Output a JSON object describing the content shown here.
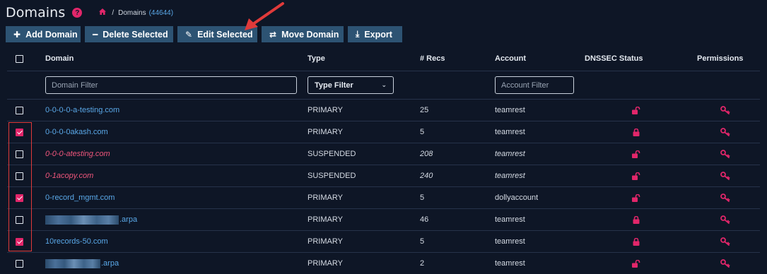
{
  "header": {
    "title": "Domains",
    "help": "?",
    "breadcrumb_sep": "/",
    "breadcrumb_label": "Domains",
    "breadcrumb_count": "(44644)"
  },
  "toolbar": {
    "add": "Add Domain",
    "delete": "Delete Selected",
    "edit": "Edit Selected",
    "move": "Move Domain",
    "export": "Export"
  },
  "columns": {
    "domain": "Domain",
    "type": "Type",
    "recs": "# Recs",
    "account": "Account",
    "dnssec": "DNSSEC Status",
    "permissions": "Permissions"
  },
  "filters": {
    "domain_placeholder": "Domain Filter",
    "type_label": "Type Filter",
    "account_placeholder": "Account Filter"
  },
  "colors": {
    "accent": "#e2266a",
    "button": "#2d5373",
    "link": "#5aa8e8",
    "suspended": "#f0567c",
    "annotation": "#e03a3a"
  },
  "rows": [
    {
      "domain": "0-0-0-0-a-testing.com",
      "type": "PRIMARY",
      "recs": "25",
      "account": "teamrest",
      "checked": false,
      "dnssec": "unlocked",
      "redacted": false,
      "suspended": false
    },
    {
      "domain": "0-0-0-0akash.com",
      "type": "PRIMARY",
      "recs": "5",
      "account": "teamrest",
      "checked": true,
      "dnssec": "locked",
      "redacted": false,
      "suspended": false
    },
    {
      "domain": "0-0-0-atesting.com",
      "type": "SUSPENDED",
      "recs": "208",
      "account": "teamrest",
      "checked": false,
      "dnssec": "unlocked",
      "redacted": false,
      "suspended": true
    },
    {
      "domain": "0-1acopy.com",
      "type": "SUSPENDED",
      "recs": "240",
      "account": "teamrest",
      "checked": false,
      "dnssec": "unlocked",
      "redacted": false,
      "suspended": true
    },
    {
      "domain": "0-record_mgmt.com",
      "type": "PRIMARY",
      "recs": "5",
      "account": "dollyaccount",
      "checked": true,
      "dnssec": "unlocked",
      "redacted": false,
      "suspended": false
    },
    {
      "domain": ".arpa",
      "type": "PRIMARY",
      "recs": "46",
      "account": "teamrest",
      "checked": false,
      "dnssec": "locked",
      "redacted": true,
      "suspended": false
    },
    {
      "domain": "10records-50.com",
      "type": "PRIMARY",
      "recs": "5",
      "account": "teamrest",
      "checked": true,
      "dnssec": "locked",
      "redacted": false,
      "suspended": false
    },
    {
      "domain": ".arpa",
      "type": "PRIMARY",
      "recs": "2",
      "account": "teamrest",
      "checked": false,
      "dnssec": "unlocked",
      "redacted": true,
      "suspended": false
    }
  ]
}
